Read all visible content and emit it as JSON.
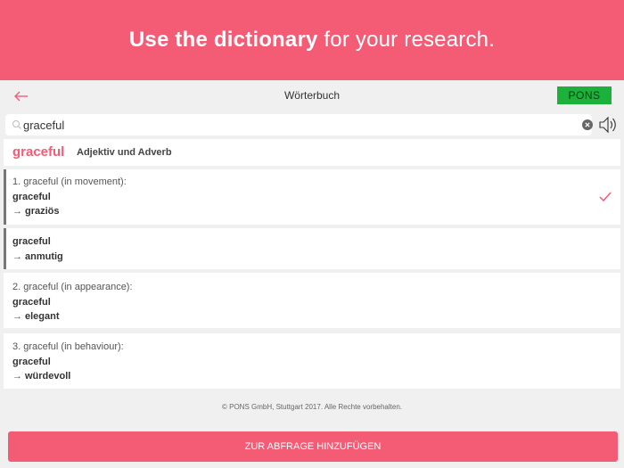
{
  "banner": {
    "bold_text": "Use the dictionary",
    "regular_text": " for your research."
  },
  "nav": {
    "back_icon": "arrow-left-icon",
    "title": "Wörterbuch",
    "logo": "PONS"
  },
  "search": {
    "value": "graceful",
    "placeholder": "",
    "search_icon": "search-icon",
    "clear_icon": "clear-icon",
    "speaker_icon": "speaker-icon"
  },
  "entry": {
    "headword": "graceful",
    "part_of_speech": "Adjektiv und Adverb",
    "senses": [
      {
        "label": "1. graceful (in movement):",
        "source": "graceful",
        "arrow": "→",
        "translation": "graziös",
        "checked": true
      },
      {
        "label": "",
        "source": "graceful",
        "arrow": "→",
        "translation": "anmutig",
        "checked": false
      },
      {
        "label": "2. graceful (in appearance):",
        "source": "graceful",
        "arrow": "→",
        "translation": "elegant",
        "checked": false
      },
      {
        "label": "3. graceful (in behaviour):",
        "source": "graceful",
        "arrow": "→",
        "translation": "würdevoll",
        "checked": false
      }
    ]
  },
  "footer": {
    "copyright": "© PONS GmbH, Stuttgart 2017. Alle Rechte vorbehalten."
  },
  "actions": {
    "add_label": "ZUR ABFRAGE HINZUFÜGEN"
  },
  "colors": {
    "accent": "#f45b75",
    "pons_green": "#1cb13a",
    "background": "#f0f0f0"
  }
}
